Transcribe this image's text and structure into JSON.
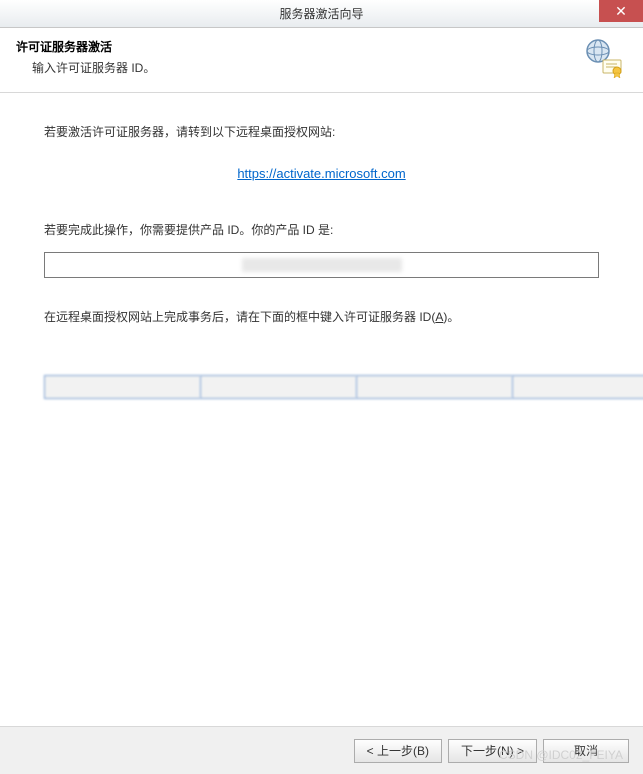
{
  "window": {
    "title": "服务器激活向导",
    "close_label": "✕"
  },
  "header": {
    "title": "许可证服务器激活",
    "subtitle": "输入许可证服务器 ID。"
  },
  "body": {
    "instruction1": "若要激活许可证服务器，请转到以下远程桌面授权网站:",
    "link_text": "https://activate.microsoft.com",
    "product_id_label": "若要完成此操作，你需要提供产品 ID。你的产品 ID 是:",
    "product_id_value": "",
    "instruction2_pre": "在远程桌面授权网站上完成事务后，请在下面的框中键入许可证服务器 ID(",
    "instruction2_key": "A",
    "instruction2_post": ")。",
    "id_fields": [
      "",
      "",
      "",
      "",
      "",
      "",
      ""
    ]
  },
  "footer": {
    "back_label": "< 上一步(B)",
    "next_label": "下一步(N) >",
    "cancel_label": "取消"
  },
  "watermark": "CSDN @IDC02_FEIYA"
}
